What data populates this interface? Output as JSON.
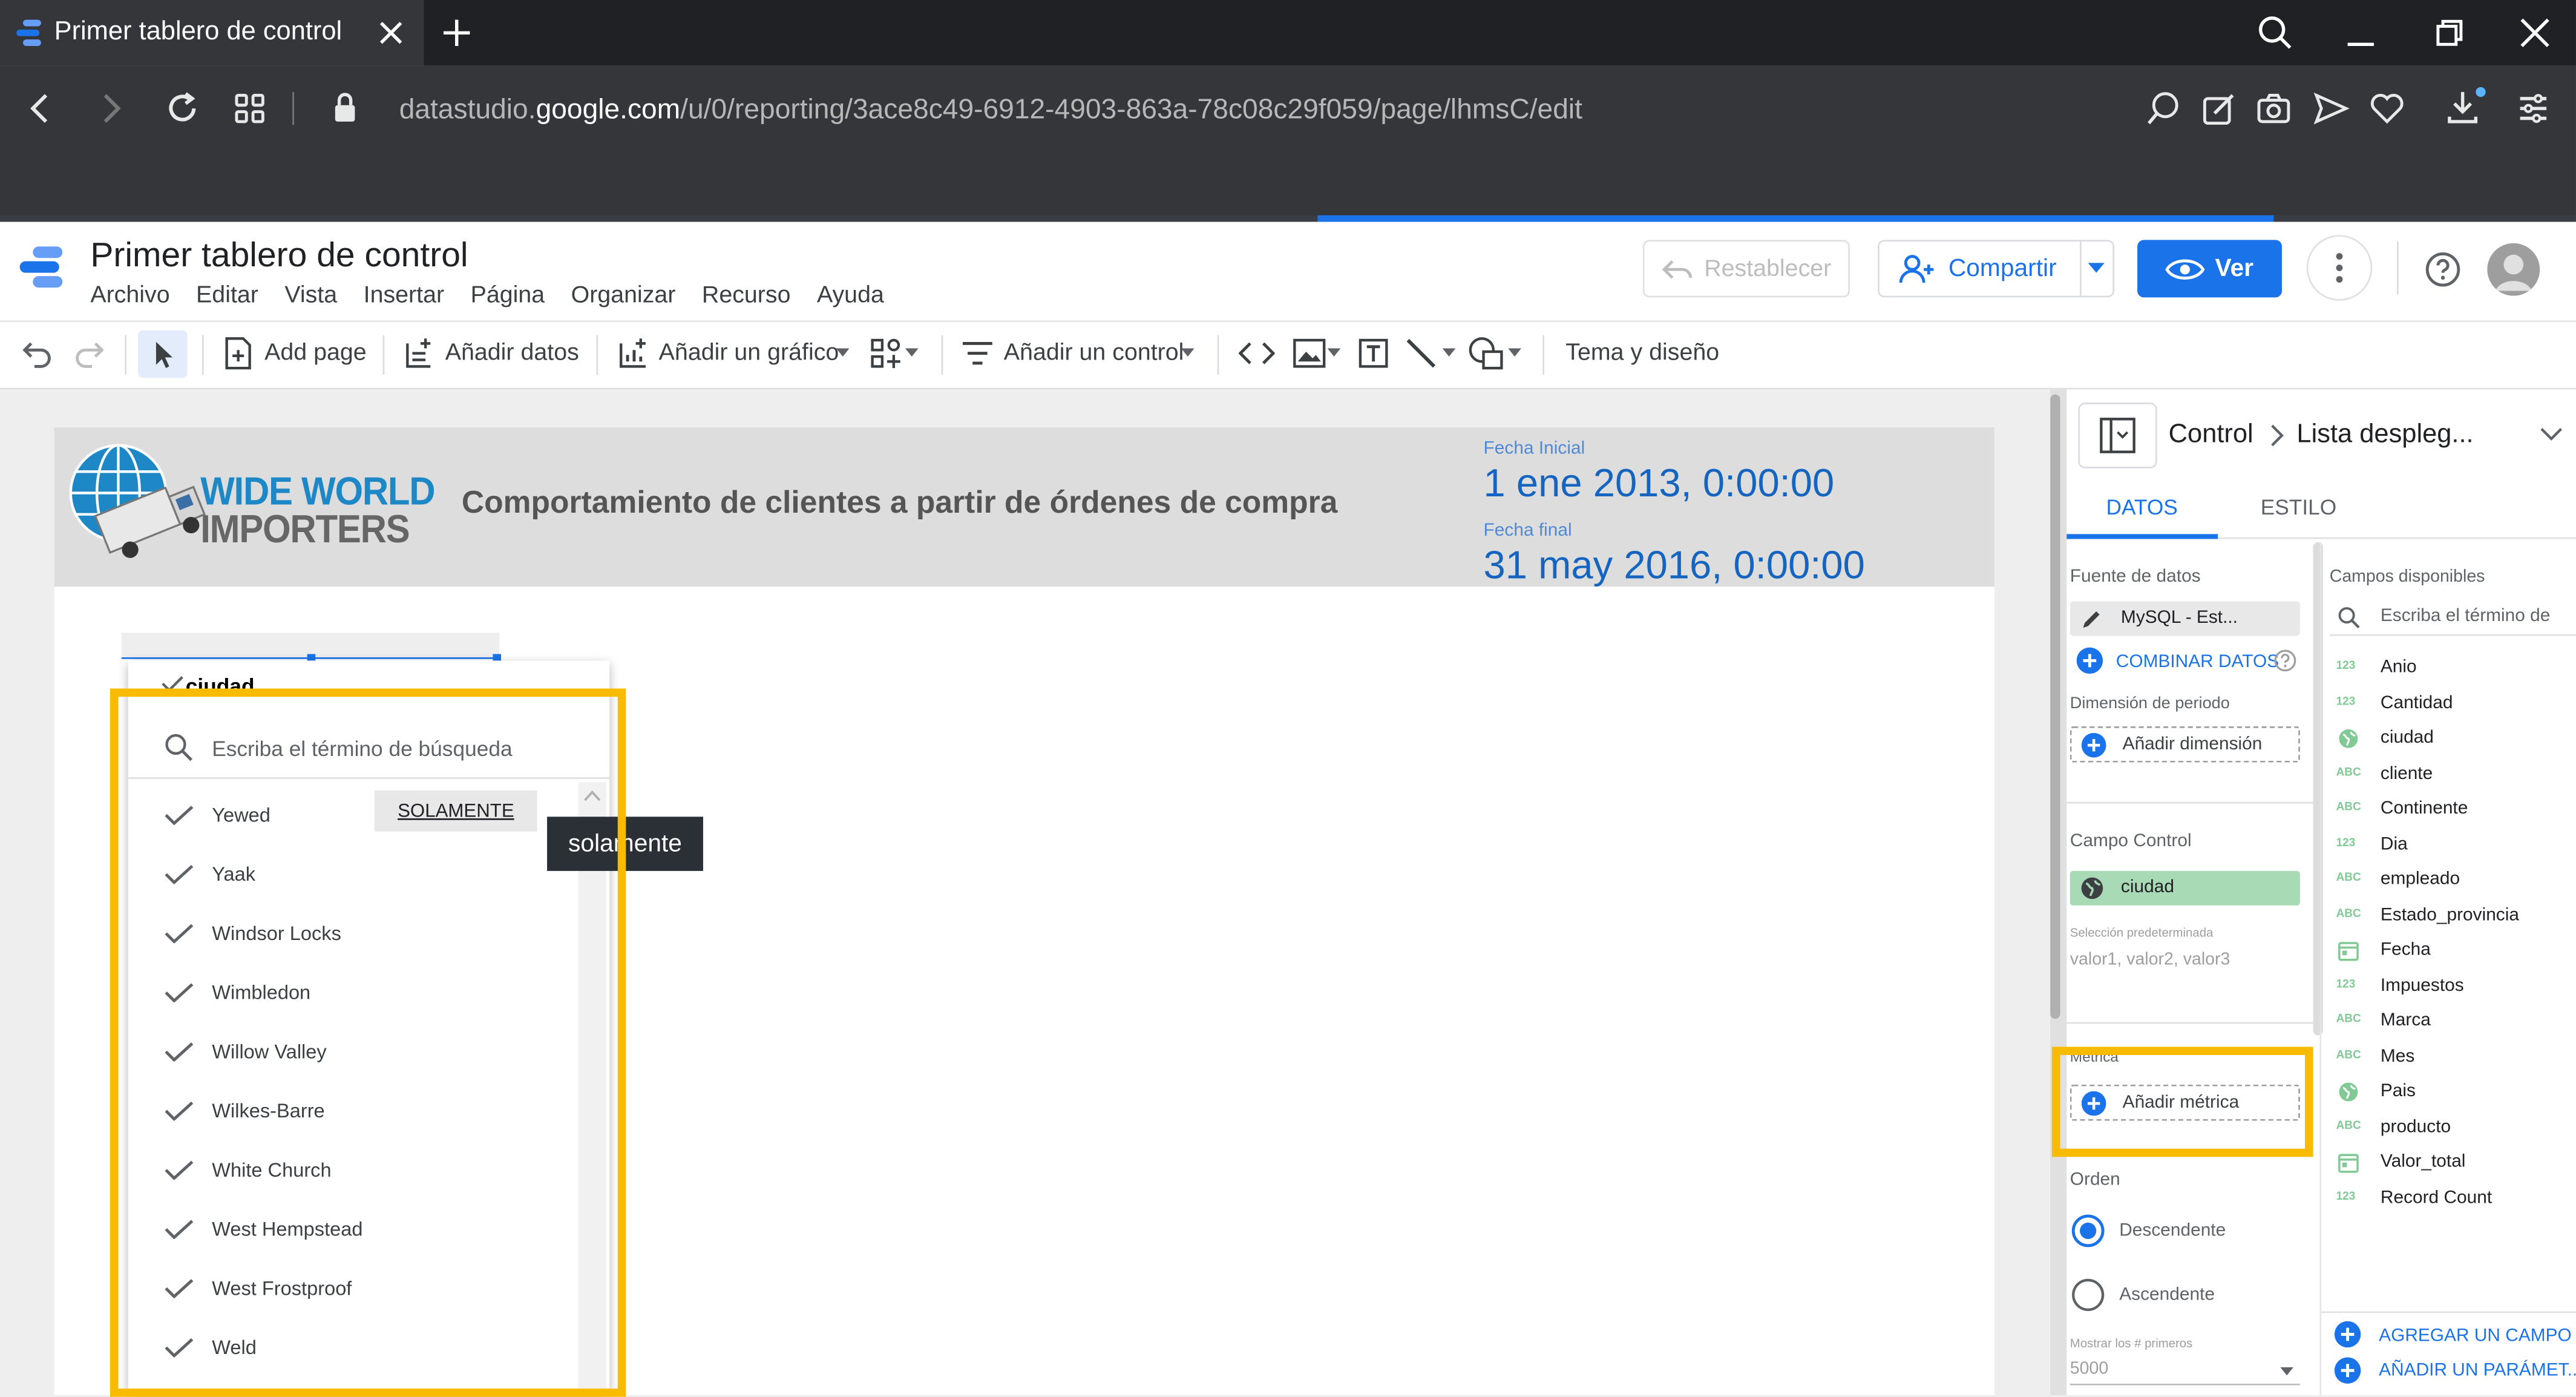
{
  "browser": {
    "tab_title": "Primer tablero de control",
    "url_prefix": "datastudio.",
    "url_domain": "google.com",
    "url_path": "/u/0/reporting/3ace8c49-6912-4903-863a-78c08c29f059/page/lhmsC/edit"
  },
  "app": {
    "title": "Primer tablero de control",
    "menu": [
      "Archivo",
      "Editar",
      "Vista",
      "Insertar",
      "Página",
      "Organizar",
      "Recurso",
      "Ayuda"
    ],
    "reset_label": "Restablecer",
    "share_label": "Compartir",
    "view_label": "Ver"
  },
  "toolbar": {
    "add_page": "Add page",
    "add_data": "Añadir datos",
    "add_chart": "Añadir un gráfico",
    "add_control": "Añadir un control",
    "theme": "Tema y diseño"
  },
  "report": {
    "logo_line1": "WIDE WORLD",
    "logo_line2": "IMPORTERS",
    "title": "Comportamiento de clientes a partir de órdenes de compra",
    "start_label": "Fecha Inicial",
    "start_value": "1 ene 2013, 0:00:00",
    "end_label": "Fecha final",
    "end_value": "31 may 2016, 0:00:00"
  },
  "dropdown": {
    "label": "ciudad",
    "search_placeholder": "Escriba el término de búsqueda",
    "only_label": "SOLAMENTE",
    "tooltip": "solamente",
    "items": [
      "Yewed",
      "Yaak",
      "Windsor Locks",
      "Wimbledon",
      "Willow Valley",
      "Wilkes-Barre",
      "White Church",
      "West Hempstead",
      "West Frostproof",
      "Weld"
    ]
  },
  "panel": {
    "breadcrumb_root": "Control",
    "breadcrumb_leaf": "Lista despleg...",
    "tab_data": "DATOS",
    "tab_style": "ESTILO",
    "datasource_label": "Fuente de datos",
    "datasource_value": "MySQL - Est...",
    "combine_label": "COMBINAR DATOS",
    "period_dim_label": "Dimensión de periodo",
    "add_dimension": "Añadir dimensión",
    "control_field_label": "Campo Control",
    "control_field_value": "ciudad",
    "default_sel_label": "Selección predeterminada",
    "default_sel_value": "valor1, valor2, valor3",
    "metric_label": "Métrica",
    "add_metric": "Añadir métrica",
    "order_label": "Orden",
    "desc_label": "Descendente",
    "asc_label": "Ascendente",
    "show_first_label": "Mostrar los # primeros",
    "show_first_value": "5000",
    "available_label": "Campos disponibles",
    "available_search": "Escriba el término de",
    "fields": [
      {
        "type": "123",
        "name": "Anio"
      },
      {
        "type": "123",
        "name": "Cantidad"
      },
      {
        "type": "geo",
        "name": "ciudad"
      },
      {
        "type": "ABC",
        "name": "cliente"
      },
      {
        "type": "ABC",
        "name": "Continente"
      },
      {
        "type": "123",
        "name": "Dia"
      },
      {
        "type": "ABC",
        "name": "empleado"
      },
      {
        "type": "ABC",
        "name": "Estado_provincia"
      },
      {
        "type": "date",
        "name": "Fecha"
      },
      {
        "type": "123",
        "name": "Impuestos"
      },
      {
        "type": "ABC",
        "name": "Marca"
      },
      {
        "type": "ABC",
        "name": "Mes"
      },
      {
        "type": "geo",
        "name": "Pais"
      },
      {
        "type": "ABC",
        "name": "producto"
      },
      {
        "type": "date",
        "name": "Valor_total"
      },
      {
        "type": "123",
        "name": "Record Count"
      }
    ],
    "add_field": "AGREGAR UN CAMPO",
    "add_param": "AÑADIR UN PARÁMET..."
  },
  "colors": {
    "accent": "#1a73e8",
    "highlight": "#f9bb00",
    "chip_green": "#a8dab5"
  }
}
